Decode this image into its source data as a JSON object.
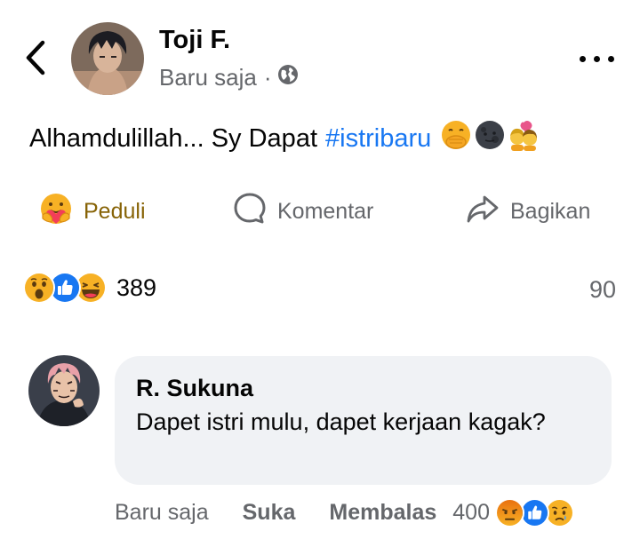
{
  "post": {
    "author": "Toji F.",
    "time": "Baru saja",
    "separator": "·",
    "privacy_icon": "globe-icon",
    "text": "Alhamdulillah... Sy Dapat",
    "hashtag": "#istribaru",
    "emojis": [
      "hand-over-mouth-face",
      "new-moon-face",
      "kiss-couple"
    ]
  },
  "actions": {
    "care_label": "Peduli",
    "comment_label": "Komentar",
    "share_label": "Bagikan"
  },
  "reactions": {
    "icons": [
      "wow",
      "like",
      "haha"
    ],
    "count": "389",
    "comments_count": "90"
  },
  "comment": {
    "author": "R. Sukuna",
    "text": "Dapet istri mulu, dapet kerjaan kagak?",
    "time": "Baru saja",
    "like_label": "Suka",
    "reply_label": "Membalas",
    "reaction_count": "400",
    "reaction_icons": [
      "angry",
      "like",
      "sad"
    ]
  },
  "colors": {
    "hashtag": "#1877f2",
    "care": "#876306",
    "muted": "#65676b",
    "bubble": "#f0f2f5",
    "like_blue": "#1877f2",
    "angry_red": "#e9710f",
    "yellow": "#f7b125"
  }
}
